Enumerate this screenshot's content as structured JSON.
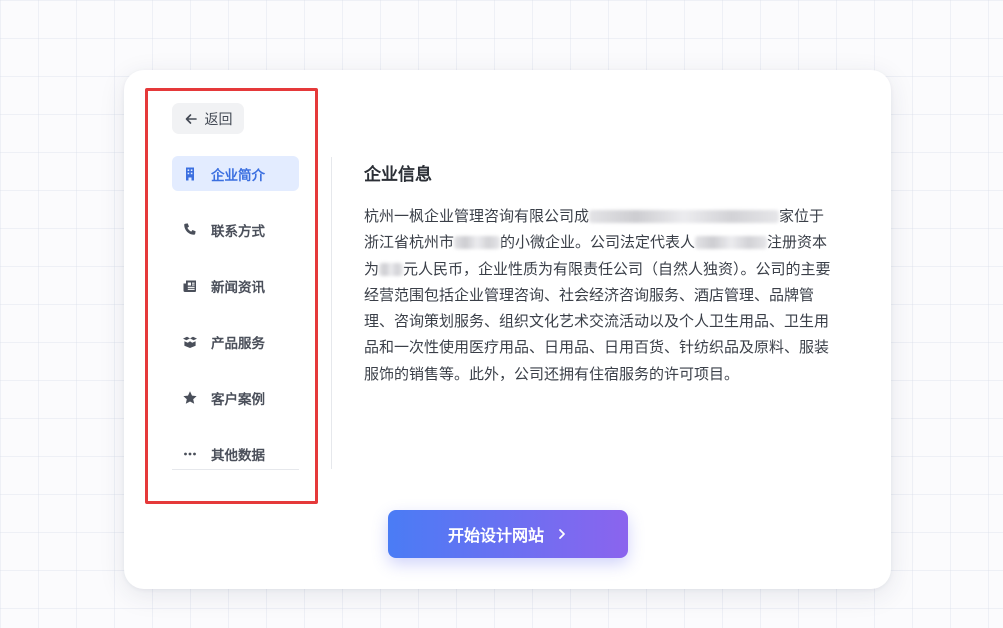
{
  "back_button": {
    "label": "返回",
    "icon": "arrow-left-icon"
  },
  "sidebar": {
    "items": [
      {
        "label": "企业简介",
        "icon": "building-icon",
        "active": true
      },
      {
        "label": "联系方式",
        "icon": "phone-icon",
        "active": false
      },
      {
        "label": "新闻资讯",
        "icon": "newspaper-icon",
        "active": false
      },
      {
        "label": "产品服务",
        "icon": "box-icon",
        "active": false
      },
      {
        "label": "客户案例",
        "icon": "star-icon",
        "active": false
      },
      {
        "label": "其他数据",
        "icon": "more-dots-icon",
        "active": false
      }
    ]
  },
  "content": {
    "title": "企业信息",
    "body": {
      "p1": "杭州一枫企业管理咨询有限公司成",
      "p2": "家位于浙江省杭州市",
      "p3": "的小微企业。公司法定代表人",
      "p4": "注册资本为",
      "p5": "元人民币，企业性质为有限责任公司（自然人独资）。公司的主要经营范围包括企业管理咨询、社会经济咨询服务、酒店管理、品牌管理、咨询策划服务、组织文化艺术交流活动以及个人卫生用品、卫生用品和一次性使用医疗用品、日用品、日用百货、针纺织品及原料、服装服饰的销售等。此外，公司还拥有住宿服务的许可项目。"
    }
  },
  "cta": {
    "label": "开始设计网站",
    "icon": "chevron-right-icon"
  },
  "colors": {
    "accent": "#3b6fe0",
    "active_bg": "#e3ecff",
    "cta_gradient_start": "#4a7cf5",
    "cta_gradient_end": "#8b64ee",
    "highlight_border": "#e5393a"
  }
}
